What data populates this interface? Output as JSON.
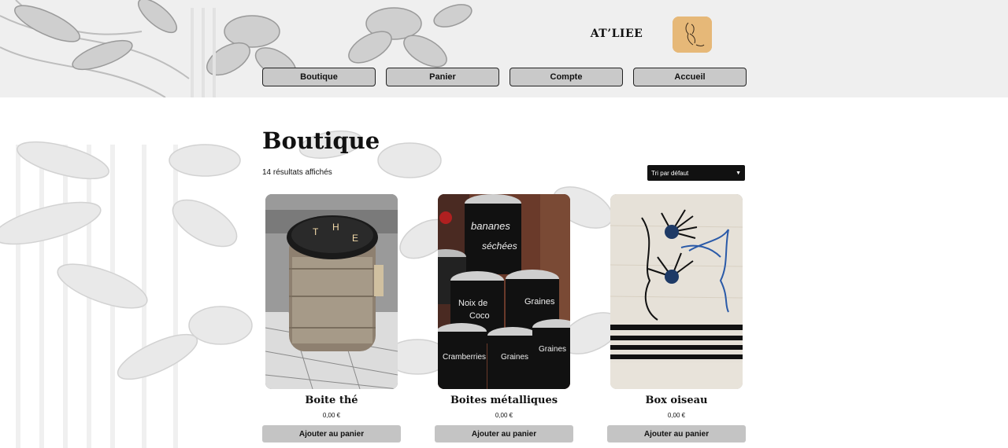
{
  "header": {
    "site_title": "AT’LIEE",
    "nav": [
      {
        "label": "Boutique"
      },
      {
        "label": "Panier"
      },
      {
        "label": "Compte"
      },
      {
        "label": "Accueil"
      }
    ]
  },
  "main": {
    "title": "Boutique",
    "result_count": "14 résultats affichés",
    "sort": {
      "selected": "Tri par défaut"
    },
    "products": [
      {
        "name": "Boite thé",
        "price": "0,00 €",
        "button": "Ajouter au panier"
      },
      {
        "name": "Boites métalliques",
        "price": "0,00 €",
        "button": "Ajouter au panier"
      },
      {
        "name": "Box oiseau",
        "price": "0,00 €",
        "button": "Ajouter au panier"
      }
    ]
  },
  "colors": {
    "header_bg": "#efefef",
    "nav_button_bg": "#c9c9c9",
    "add_button_bg": "#c4c4c4",
    "select_bg": "#111111",
    "logo_bg": "#e6b878"
  }
}
